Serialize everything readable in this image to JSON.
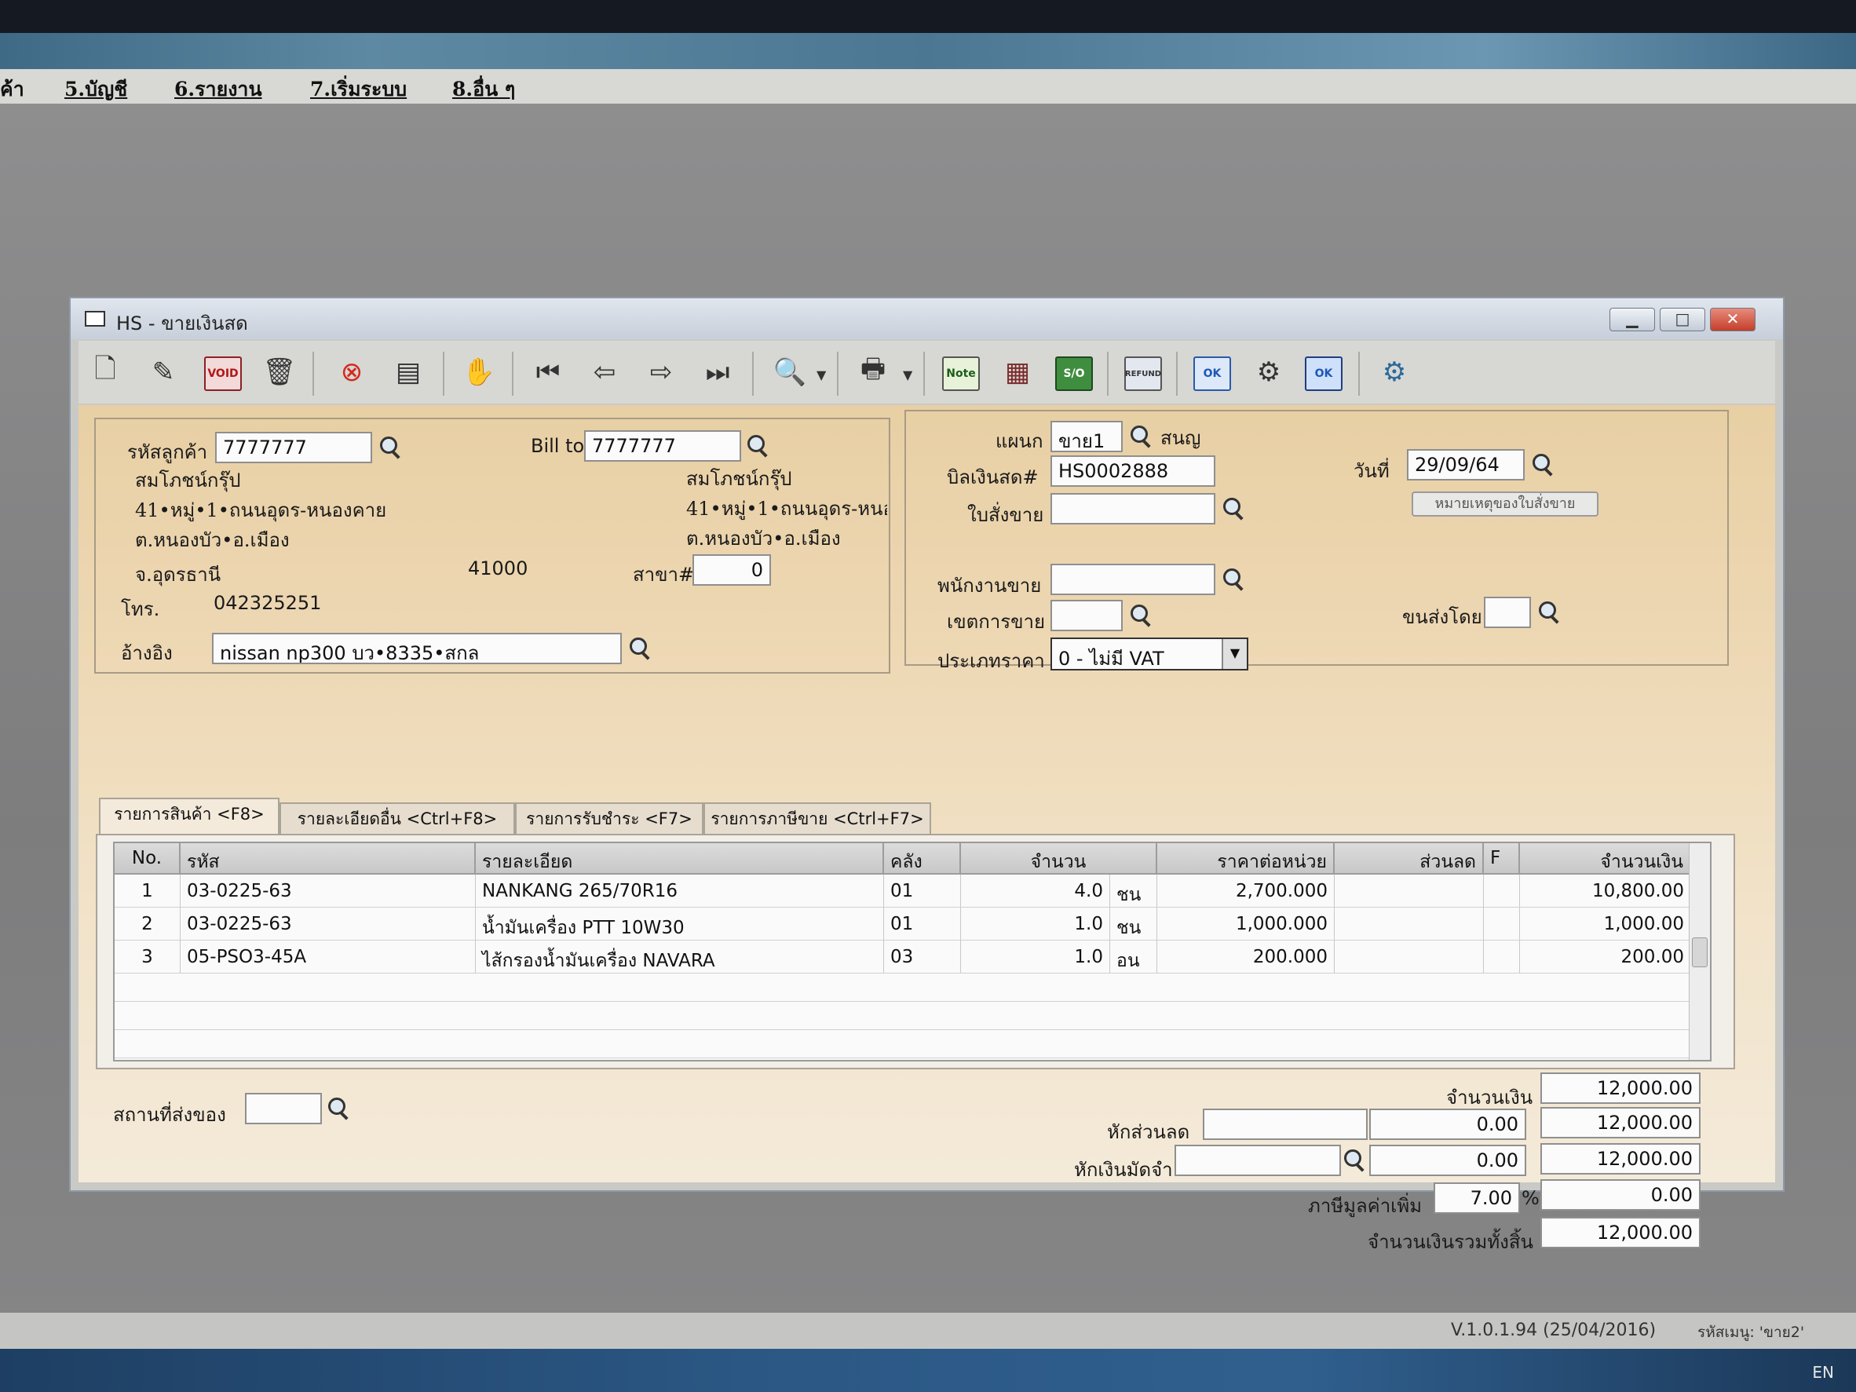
{
  "menu": {
    "items": [
      "ค้า",
      "5.บัญชี",
      "6.รายงาน",
      "7.เริ่มระบบ",
      "8.อื่น ๆ"
    ]
  },
  "window": {
    "title": "HS - ขายเงินสด",
    "controls": [
      "minimize",
      "maximize",
      "close"
    ]
  },
  "toolbar": {
    "buttons": [
      {
        "name": "new-document-icon"
      },
      {
        "name": "edit-icon"
      },
      {
        "name": "void-icon",
        "label": "VOID"
      },
      {
        "name": "trash-icon"
      },
      {
        "name": "cancel-icon"
      },
      {
        "name": "save-icon"
      },
      {
        "name": "handshake-icon"
      },
      {
        "name": "first-record-icon"
      },
      {
        "name": "previous-record-icon"
      },
      {
        "name": "next-record-icon"
      },
      {
        "name": "last-record-icon"
      },
      {
        "name": "search-icon"
      },
      {
        "name": "print-icon"
      },
      {
        "name": "note-icon",
        "label": "Note"
      },
      {
        "name": "calculator-icon"
      },
      {
        "name": "sales-order-icon",
        "label": "S/O"
      },
      {
        "name": "refund-icon",
        "label": "REFUND"
      },
      {
        "name": "approve-icon",
        "label": "OK"
      },
      {
        "name": "tools-icon"
      },
      {
        "name": "confirm-ok-icon",
        "label": "OK"
      },
      {
        "name": "settings-icon"
      }
    ]
  },
  "customer": {
    "code_label": "รหัสลูกค้า",
    "code": "7777777",
    "name": "สมโภชน์กรุ๊ป",
    "address1": "41•หมู่•1•ถนนอุดร-หนองคาย",
    "address2": "ต.หนองบัว•อ.เมือง",
    "province": "จ.อุดรธานี",
    "postcode": "41000",
    "phone_label": "โทร.",
    "phone": "042325251",
    "ref_label": "อ้างอิง",
    "ref": "nissan np300 บว•8335•สกล"
  },
  "billto": {
    "label": "Bill to",
    "code": "7777777",
    "name": "สมโภชน์กรุ๊ป",
    "address1": "41•หมู่•1•ถนนอุดร-หนอ",
    "address2": "ต.หนองบัว•อ.เมือง",
    "branch_label": "สาขา#",
    "branch": "0"
  },
  "doc": {
    "dept_label": "แผนก",
    "dept": "ขาย1",
    "dept_name": "สนญ",
    "bill_label": "บิลเงินสด#",
    "bill": "HS0002888",
    "order_label": "ใบสั่งขาย",
    "order": "",
    "date_label": "วันที่",
    "date": "29/09/64",
    "order_note_button": "หมายเหตุของใบสั่งขาย",
    "salesman_label": "พนักงานขาย",
    "salesman": "",
    "area_label": "เขตการขาย",
    "area": "",
    "ship_by_label": "ขนส่งโดย",
    "ship_by": "",
    "price_type_label": "ประเภทราคา",
    "price_type": "0 - ไม่มี VAT"
  },
  "tabs": [
    "รายการสินค้า <F8>",
    "รายละเอียดอื่น <Ctrl+F8>",
    "รายการรับชำระ <F7>",
    "รายการภาษีขาย <Ctrl+F7>"
  ],
  "grid": {
    "headers": [
      "No.",
      "รหัส",
      "รายละเอียด",
      "คลัง",
      "จำนวน",
      "ราคาต่อหน่วย",
      "ส่วนลด",
      "F",
      "จำนวนเงิน"
    ],
    "rows": [
      {
        "no": "1",
        "code": "03-0225-63",
        "desc": "NANKANG 265/70R16",
        "wh": "01",
        "qty": "4.0",
        "unit": "ชน",
        "price": "2,700.000",
        "disc": "",
        "f": "",
        "amount": "10,800.00"
      },
      {
        "no": "2",
        "code": "03-0225-63",
        "desc": "น้ำมันเครื่อง PTT 10W30",
        "wh": "01",
        "qty": "1.0",
        "unit": "ชน",
        "price": "1,000.000",
        "disc": "",
        "f": "",
        "amount": "1,000.00"
      },
      {
        "no": "3",
        "code": "05-PSO3-45A",
        "desc": "ไส้กรองน้ำมันเครื่อง NAVARA",
        "wh": "03",
        "qty": "1.0",
        "unit": "อน",
        "price": "200.000",
        "disc": "",
        "f": "",
        "amount": "200.00"
      }
    ]
  },
  "footer": {
    "ship_place_label": "สถานที่ส่งของ",
    "ship_place": "",
    "amount_label": "จำนวนเงิน",
    "amount": "12,000.00",
    "discount_label": "หักส่วนลด",
    "discount_text": "",
    "discount_value": "0.00",
    "after_discount": "12,000.00",
    "deposit_label": "หักเงินมัดจำ",
    "deposit_text": "",
    "deposit_value": "0.00",
    "after_deposit": "12,000.00",
    "vat_label": "ภาษีมูลค่าเพิ่ม",
    "vat_rate": "7.00",
    "vat_pct": "%",
    "vat_amount": "0.00",
    "total_label": "จำนวนเงินรวมทั้งสิ้น",
    "total": "12,000.00"
  },
  "status": {
    "version": "V.1.0.1.94 (25/04/2016)",
    "menu_code": "รหัสเมนู: 'ขาย2'",
    "lang": "EN"
  }
}
